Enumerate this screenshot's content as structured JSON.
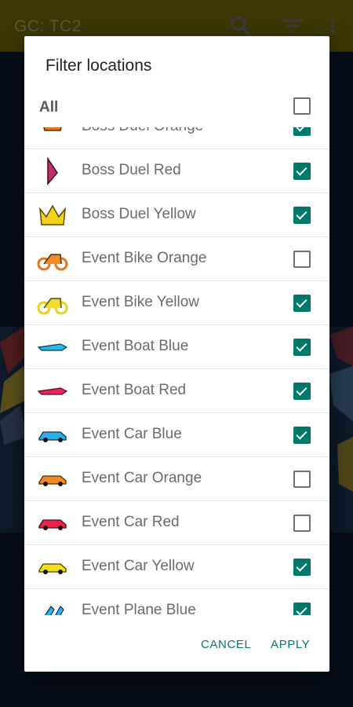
{
  "appbar": {
    "title": "GC: TC2",
    "icons": [
      "search-icon",
      "filter-icon",
      "more-vert-icon"
    ]
  },
  "dialog": {
    "title": "Filter locations",
    "all": {
      "label": "All",
      "checked": false
    },
    "items": [
      {
        "label": "Boss Duel Orange",
        "icon": "boss-duel-orange-icon",
        "checked": true
      },
      {
        "label": "Boss Duel Red",
        "icon": "boss-duel-red-icon",
        "checked": true
      },
      {
        "label": "Boss Duel Yellow",
        "icon": "boss-duel-yellow-icon",
        "checked": true
      },
      {
        "label": "Event Bike Orange",
        "icon": "bike-orange-icon",
        "checked": false
      },
      {
        "label": "Event Bike Yellow",
        "icon": "bike-yellow-icon",
        "checked": true
      },
      {
        "label": "Event Boat Blue",
        "icon": "boat-blue-icon",
        "checked": true
      },
      {
        "label": "Event Boat Red",
        "icon": "boat-red-icon",
        "checked": true
      },
      {
        "label": "Event Car Blue",
        "icon": "car-blue-icon",
        "checked": true
      },
      {
        "label": "Event Car Orange",
        "icon": "car-orange-icon",
        "checked": false
      },
      {
        "label": "Event Car Red",
        "icon": "car-red-icon",
        "checked": false
      },
      {
        "label": "Event Car Yellow",
        "icon": "car-yellow-icon",
        "checked": true
      },
      {
        "label": "Event Plane Blue",
        "icon": "plane-blue-icon",
        "checked": true
      }
    ],
    "cancel_label": "CANCEL",
    "apply_label": "APPLY"
  },
  "colors": {
    "accent": "#00796b",
    "appbar": "#5e5308"
  }
}
